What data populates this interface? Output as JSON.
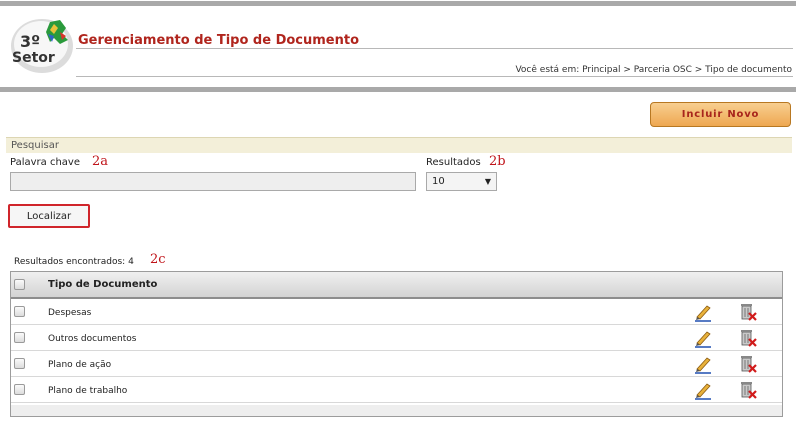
{
  "header": {
    "title": "Gerenciamento de Tipo de Documento",
    "breadcrumb": "Você está em: Principal > Parceria OSC > Tipo de documento",
    "logo_text_top": "3º",
    "logo_text_bottom": "Setor"
  },
  "toolbar": {
    "new_label": "Incluir Novo"
  },
  "search": {
    "section_title": "Pesquisar",
    "keyword_label": "Palavra chave",
    "keyword_value": "",
    "keyword_marker": "2a",
    "results_label": "Resultados",
    "results_value": "10",
    "results_marker": "2b",
    "find_label": "Localizar"
  },
  "results": {
    "count_label": "Resultados encontrados:",
    "count": "4",
    "count_marker": "2c"
  },
  "table": {
    "column": "Tipo de Documento",
    "rows": [
      {
        "label": "Despesas"
      },
      {
        "label": "Outros documentos"
      },
      {
        "label": "Plano de ação"
      },
      {
        "label": "Plano de trabalho"
      }
    ]
  },
  "colors": {
    "title": "#b0251d",
    "accent_button": "#eea751",
    "marker": "#c0141a"
  },
  "icons": {
    "edit": "pencil-icon",
    "delete": "trash-delete-icon"
  }
}
